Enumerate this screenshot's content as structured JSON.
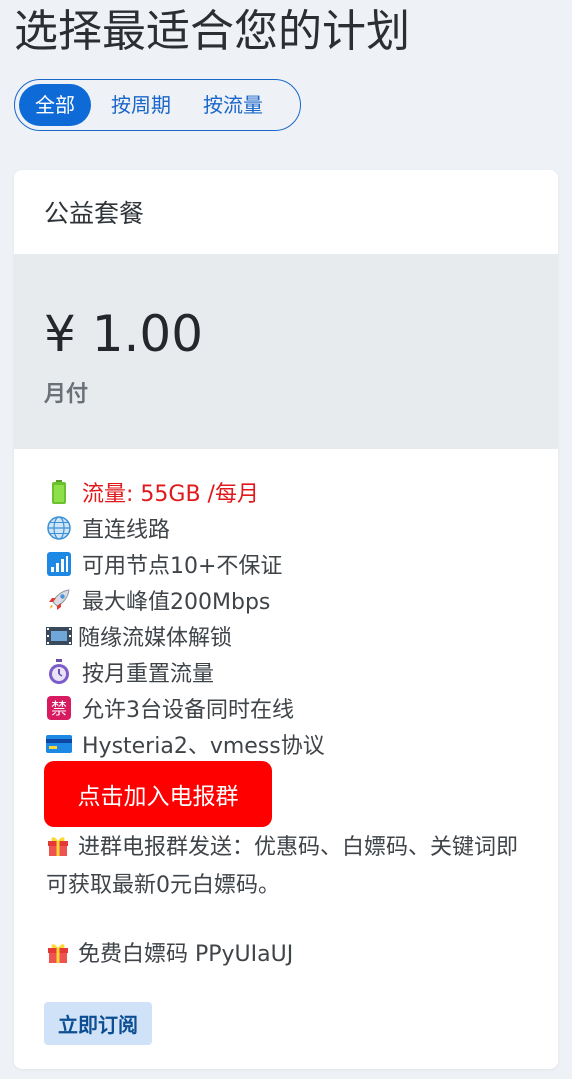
{
  "page": {
    "title": "选择最适合您的计划"
  },
  "filters": {
    "tabs": [
      {
        "label": "全部",
        "active": true
      },
      {
        "label": "按周期",
        "active": false
      },
      {
        "label": "按流量",
        "active": false
      }
    ]
  },
  "plan": {
    "name": "公益套餐",
    "price": "¥ 1.00",
    "period": "月付",
    "features": [
      {
        "icon": "battery-icon",
        "text": "流量: 55GB /每月",
        "color": "#e0191b"
      },
      {
        "icon": "globe-icon",
        "text": "直连线路"
      },
      {
        "icon": "signal-bars-icon",
        "text": "可用节点10+不保证"
      },
      {
        "icon": "rocket-icon",
        "text": "最大峰值200Mbps"
      },
      {
        "icon": "film-icon",
        "text": "随缘流媒体解锁"
      },
      {
        "icon": "stopwatch-icon",
        "text": "按月重置流量"
      },
      {
        "icon": "prohibited-sign-icon",
        "text": "允许3台设备同时在线"
      },
      {
        "icon": "credit-card-icon",
        "text": "Hysteria2、vmess协议"
      }
    ],
    "telegram_button": "点击加入电报群",
    "promo_text": "进群电报群发送：优惠码、白嫖码、关键词即可获取最新0元白嫖码。",
    "free_code_text": "免费白嫖码 PPyUIaUJ",
    "subscribe_button": "立即订阅"
  },
  "colors": {
    "accent": "#0d6ad6",
    "telegram": "#fe0000",
    "traffic_text": "#e0191b",
    "subscribe_bg": "#cfe2f8"
  }
}
